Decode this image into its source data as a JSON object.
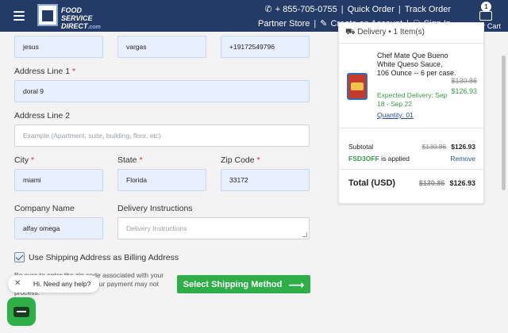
{
  "header": {
    "logo_line1": "FOOD SERVICE",
    "logo_line2": "DIRECT",
    "logo_com": ".com",
    "phone": "+ 855-705-0755",
    "quick_order": "Quick Order",
    "track_order": "Track Order",
    "partner_store": "Partner Store",
    "create_account": "Create an Account",
    "sign_in": "Sign In",
    "cart_count": "1",
    "cart_label": "Your Cart"
  },
  "form": {
    "first_name": "jesus",
    "last_name": "vargas",
    "phone": "+19172549796",
    "address1_label": "Address Line 1",
    "address1": "doral 9",
    "address2_label": "Address Line 2",
    "address2_placeholder": "Example (Apartment, suite, building, floor, etc)",
    "city_label": "City",
    "city": "miami",
    "state_label": "State",
    "state": "Florida",
    "zip_label": "Zip Code",
    "zip": "33172",
    "company_label": "Company Name",
    "company": "alfay omega",
    "instructions_label": "Delivery Instructions",
    "instructions_placeholder": "Delivery Instructions",
    "required_mark": "*",
    "billing_checkbox_label": "Use Shipping Address as Billing Address",
    "billing_checked": true,
    "note": "Be sure to enter the zip code associated with your billing address, otherwise your payment may not process.",
    "submit_label": "Select Shipping Method",
    "submit_arrow": "⟶"
  },
  "chat": {
    "greeting": "Hi. Need any help?",
    "close": "✕"
  },
  "summary": {
    "delivery_heading": "Delivery • 1 Item(s)",
    "product_name": "Chef Mate Que Bueno White Queso Sauce, 106 Ounce -- 6 per case.",
    "price_old": "$130.86",
    "price_new": "$126.93",
    "expected_delivery": "Expected Delivery: Sep 18 - Sep 22",
    "quantity": "Quantity: 01",
    "subtotal_label": "Subtotal",
    "subtotal_old": "$130.86",
    "subtotal_new": "$126.93",
    "promo_code": "FSD3OFF",
    "promo_text": "is applied",
    "remove_label": "Remove",
    "total_label": "Total (USD)",
    "total_old": "$130.86",
    "total_new": "$126.93"
  },
  "colors": {
    "header_bg": "#233b66",
    "accent_green": "#2eae46",
    "input_fill": "#e8efff"
  },
  "icons": [
    "hamburger-icon",
    "phone-icon",
    "edit-icon",
    "user-icon",
    "cart-icon",
    "truck-icon",
    "chat-icon",
    "arrow-right-icon",
    "close-icon"
  ]
}
